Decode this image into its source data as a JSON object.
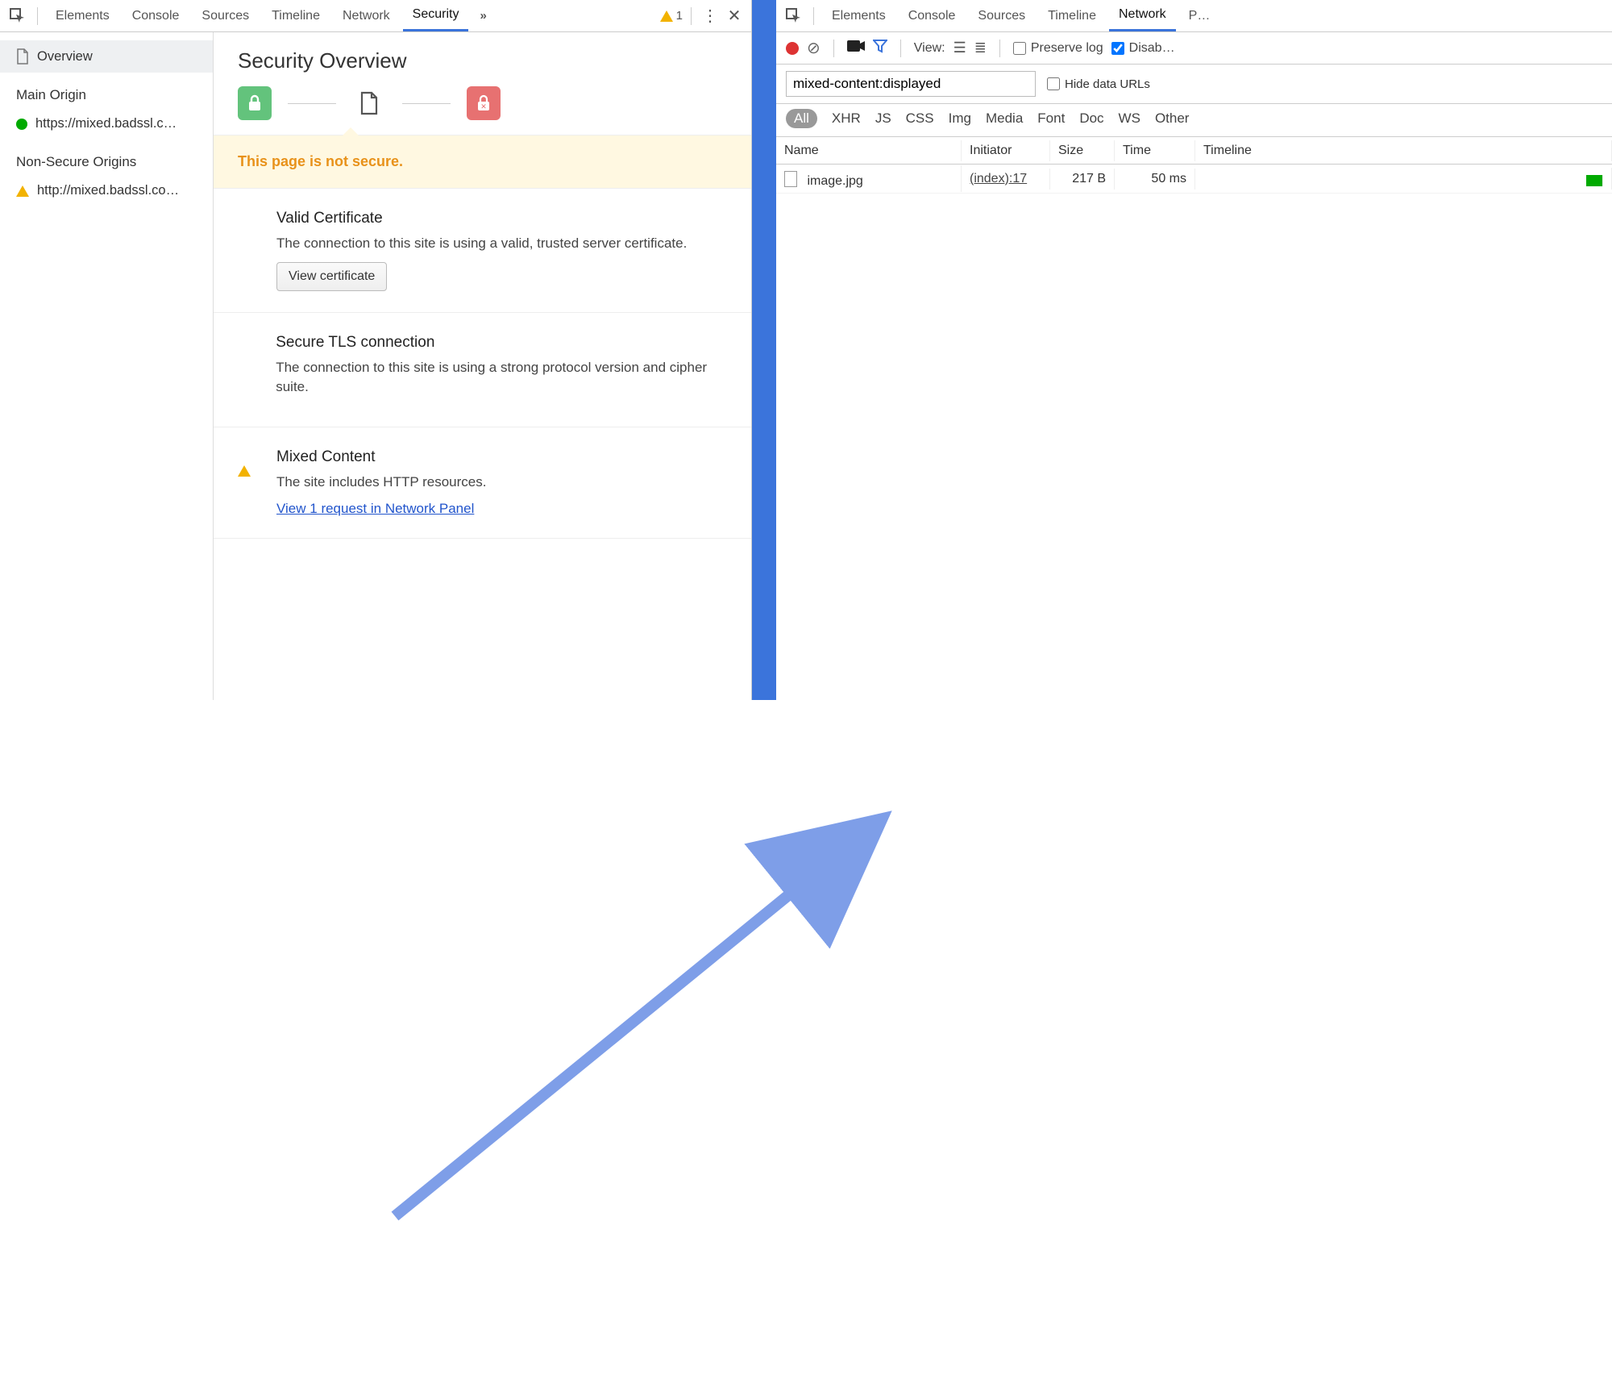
{
  "left": {
    "tabs": [
      "Elements",
      "Console",
      "Sources",
      "Timeline",
      "Network",
      "Security"
    ],
    "active_tab": "Security",
    "warn_count": "1",
    "sidebar": {
      "overview_label": "Overview",
      "main_origin_heading": "Main Origin",
      "main_origin_url": "https://mixed.badssl.c…",
      "nonsecure_heading": "Non-Secure Origins",
      "nonsecure_url": "http://mixed.badssl.co…"
    },
    "overview": {
      "title": "Security Overview",
      "banner": "This page is not secure.",
      "blocks": [
        {
          "indicator": "green",
          "title": "Valid Certificate",
          "text": "The connection to this site is using a valid, trusted server certificate.",
          "button": "View certificate"
        },
        {
          "indicator": "green",
          "title": "Secure TLS connection",
          "text": "The connection to this site is using a strong protocol version and cipher suite."
        },
        {
          "indicator": "warn",
          "title": "Mixed Content",
          "text": "The site includes HTTP resources.",
          "link": "View 1 request in Network Panel"
        }
      ]
    }
  },
  "right": {
    "tabs": [
      "Elements",
      "Console",
      "Sources",
      "Timeline",
      "Network",
      "P…"
    ],
    "active_tab": "Network",
    "toolbar": {
      "view_label": "View:",
      "preserve_label": "Preserve log",
      "disable_label": "Disab…"
    },
    "filter": {
      "value": "mixed-content:displayed",
      "hide_label": "Hide data URLs",
      "types": [
        "All",
        "XHR",
        "JS",
        "CSS",
        "Img",
        "Media",
        "Font",
        "Doc",
        "WS",
        "Other"
      ],
      "active_type": "All"
    },
    "columns": [
      "Name",
      "Initiator",
      "Size",
      "Time",
      "Timeline"
    ],
    "rows": [
      {
        "name": "image.jpg",
        "initiator": "(index):17",
        "size": "217 B",
        "time": "50 ms"
      }
    ]
  }
}
